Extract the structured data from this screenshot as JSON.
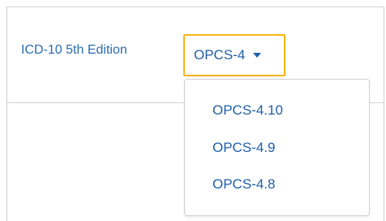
{
  "nav": {
    "link_label": "ICD-10 5th Edition",
    "dropdown": {
      "selected_label": "OPCS-4",
      "options": [
        "OPCS-4.10",
        "OPCS-4.9",
        "OPCS-4.8"
      ]
    }
  },
  "colors": {
    "link": "#2b6cb0",
    "focus_outline": "#f5b617"
  }
}
